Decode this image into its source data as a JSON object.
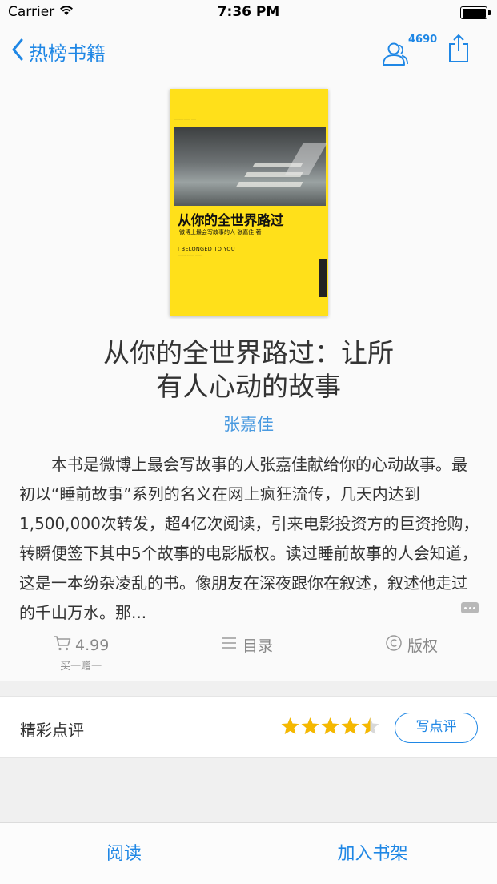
{
  "status_bar": {
    "carrier": "Carrier",
    "time": "7:36 PM"
  },
  "nav": {
    "back_label": "热榜书籍",
    "reader_count": "4690",
    "icons": {
      "back": "chevron-left-icon",
      "readers": "readers-icon",
      "share": "share-icon"
    }
  },
  "cover": {
    "title": "从你的全世界路过",
    "author_line": "微博上最会写故事的人 张嘉佳 著",
    "english_title": "I BELONGED TO YOU"
  },
  "book": {
    "title_line1": "从你的全世界路过：让所",
    "title_line2": "有人心动的故事",
    "author": "张嘉佳",
    "description": "本书是微博上最会写故事的人张嘉佳献给你的心动故事。最初以“睡前故事”系列的名义在网上疯狂流传，几天内达到1,500,000次转发，超4亿次阅读，引来电影投资方的巨资抢购，转瞬便签下其中5个故事的电影版权。读过睡前故事的人会知道，这是一本纷杂凌乱的书。像朋友在深夜跟你在叙述，叙述他走过的千山万水。那..."
  },
  "actions": {
    "price": "4.99",
    "price_sub": "买一赠一",
    "toc": "目录",
    "copyright": "版权"
  },
  "reviews": {
    "label": "精彩点评",
    "rating": 4.5,
    "rating_max": 5,
    "write_button": "写点评"
  },
  "bottom": {
    "read": "阅读",
    "add_shelf": "加入书架"
  },
  "colors": {
    "accent": "#1f87e5",
    "author_link": "#4a9ae0",
    "star": "#f5b800",
    "cover_yellow": "#ffe01a"
  }
}
